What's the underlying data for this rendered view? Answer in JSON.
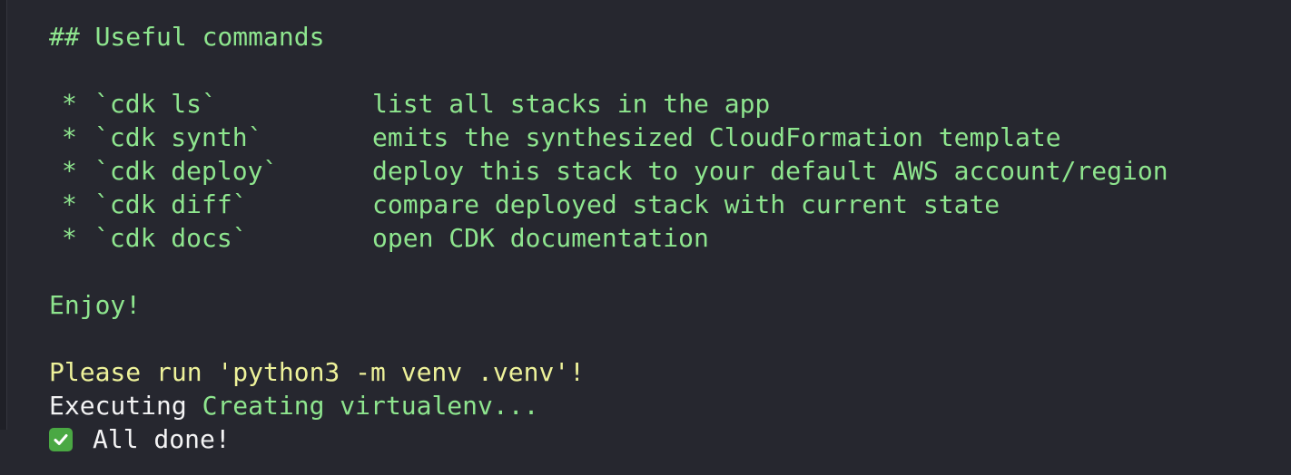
{
  "terminal": {
    "heading": "## Useful commands",
    "commands": [
      {
        "bullet": "*",
        "name": "`cdk ls`",
        "description": "list all stacks in the app"
      },
      {
        "bullet": "*",
        "name": "`cdk synth`",
        "description": "emits the synthesized CloudFormation template"
      },
      {
        "bullet": "*",
        "name": "`cdk deploy`",
        "description": "deploy this stack to your default AWS account/region"
      },
      {
        "bullet": "*",
        "name": "`cdk diff`",
        "description": "compare deployed stack with current state"
      },
      {
        "bullet": "*",
        "name": "`cdk docs`",
        "description": "open CDK documentation"
      }
    ],
    "enjoy": "Enjoy!",
    "venv_prompt": "Please run 'python3 -m venv .venv'!",
    "executing_label": "Executing",
    "executing_task": "Creating virtualenv...",
    "done_icon": "check-mark-icon",
    "done_text": "All done!"
  },
  "colors": {
    "background": "#26272f",
    "green": "#8ee58e",
    "yellow": "#eef29a",
    "white": "#f3f3f4",
    "check_bg": "#4aa843"
  }
}
